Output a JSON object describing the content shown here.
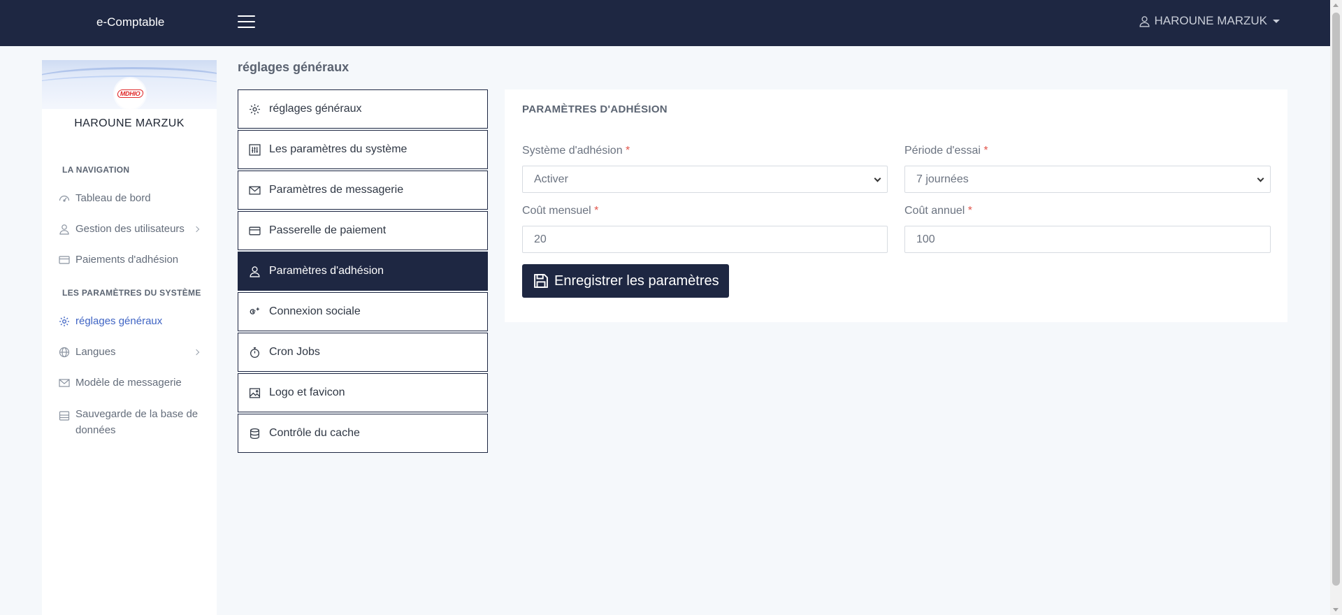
{
  "app": {
    "brand": "e-Comptable"
  },
  "header": {
    "user_name": "HAROUNE MARZUK"
  },
  "sidebar": {
    "profile_name": "HAROUNE MARZUK",
    "logo_text": "MDHIO",
    "sections": [
      {
        "title": "LA NAVIGATION",
        "items": [
          {
            "label": "Tableau de bord",
            "icon": "dashboard-icon"
          },
          {
            "label": "Gestion des utilisateurs",
            "icon": "user-icon",
            "has_submenu": true
          },
          {
            "label": "Paiements d'adhésion",
            "icon": "credit-card-icon"
          }
        ]
      },
      {
        "title": "LES PARAMÈTRES DU SYSTÈME",
        "items": [
          {
            "label": "réglages généraux",
            "icon": "gear-icon",
            "active": true
          },
          {
            "label": "Langues",
            "icon": "globe-icon",
            "has_submenu": true
          },
          {
            "label": "Modèle de messagerie",
            "icon": "envelope-icon"
          },
          {
            "label": "Sauvegarde de la base de données",
            "icon": "database-backup-icon"
          }
        ]
      }
    ]
  },
  "main": {
    "page_title": "réglages généraux",
    "settings_menu": [
      {
        "label": "réglages généraux",
        "icon": "gear-icon"
      },
      {
        "label": "Les paramètres du système",
        "icon": "sliders-icon"
      },
      {
        "label": "Paramètres de messagerie",
        "icon": "envelope-icon"
      },
      {
        "label": "Passerelle de paiement",
        "icon": "credit-card-icon"
      },
      {
        "label": "Paramètres d'adhésion",
        "icon": "user-icon",
        "active": true
      },
      {
        "label": "Connexion sociale",
        "icon": "google-plus-icon"
      },
      {
        "label": "Cron Jobs",
        "icon": "stopwatch-icon"
      },
      {
        "label": "Logo et favicon",
        "icon": "image-icon"
      },
      {
        "label": "Contrôle du cache",
        "icon": "database-icon"
      }
    ],
    "form": {
      "title": "PARAMÈTRES D'ADHÉSION",
      "membership_system": {
        "label": "Système d'adhésion",
        "required_mark": "*",
        "value": "Activer"
      },
      "trial_period": {
        "label": "Période d'essai",
        "required_mark": "*",
        "value": "7 journées"
      },
      "monthly_cost": {
        "label": "Coût mensuel",
        "required_mark": "*",
        "value": "20"
      },
      "annual_cost": {
        "label": "Coût annuel",
        "required_mark": "*",
        "value": "100"
      },
      "save_label": "Enregistrer les paramètres"
    }
  },
  "colors": {
    "navy": "#1e2742",
    "active_link": "#3f64c4",
    "required": "#e2554b"
  }
}
